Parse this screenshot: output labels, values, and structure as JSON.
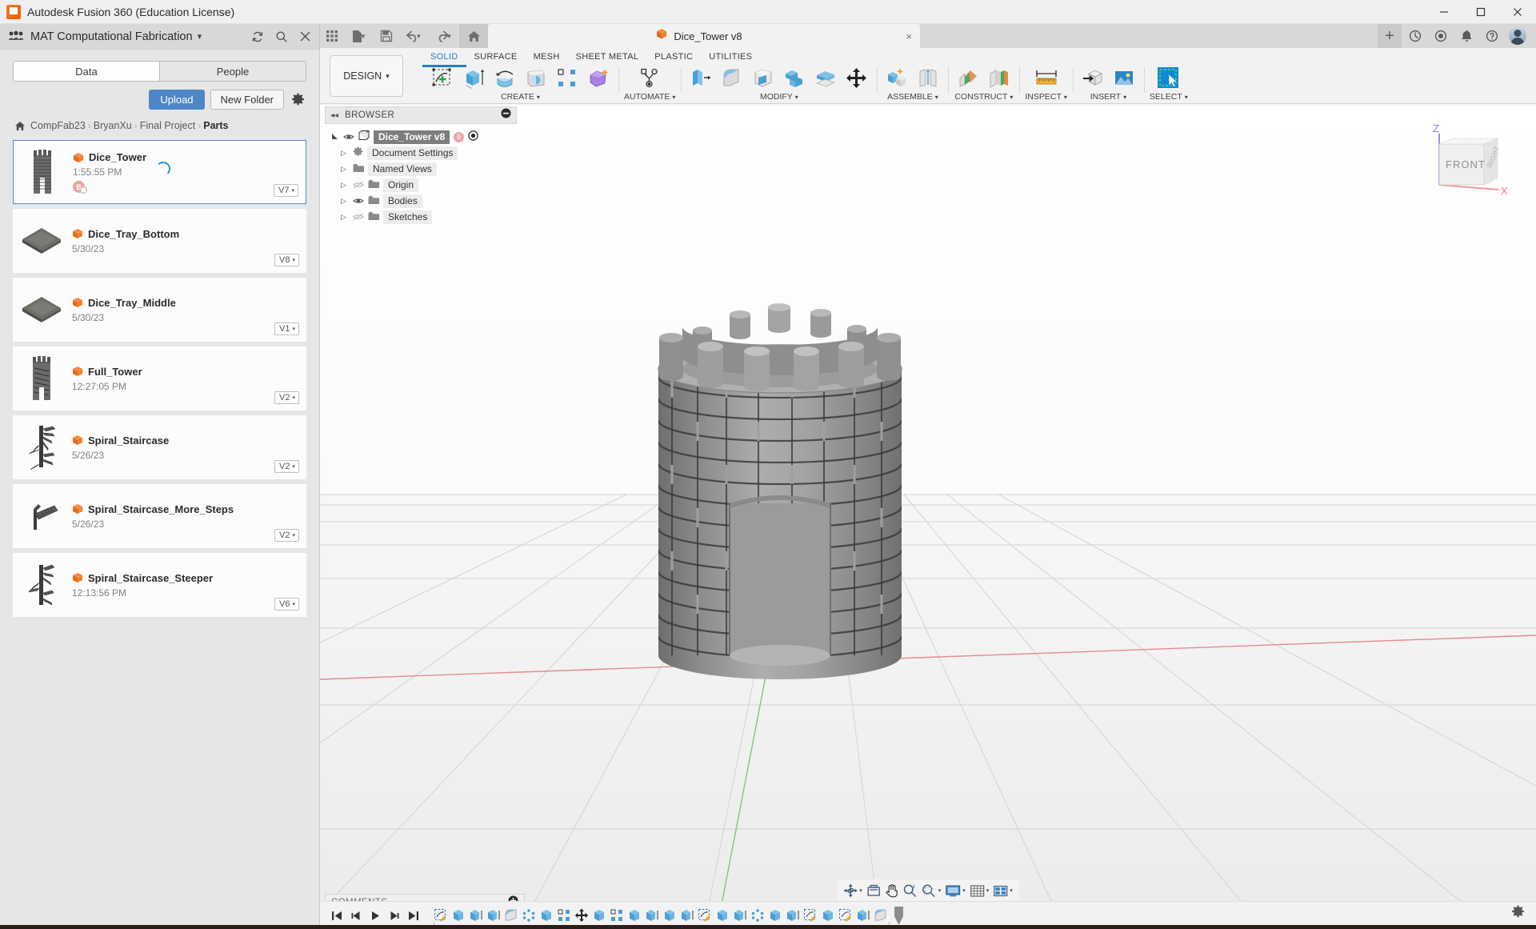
{
  "window": {
    "title": "Autodesk Fusion 360 (Education License)",
    "icon": "fusion-app-icon",
    "minimize": "minimize-icon",
    "maximize": "maximize-icon",
    "close": "close-icon"
  },
  "data_panel": {
    "hub_name": "MAT Computational Fabrication",
    "hub_caret": "▾",
    "header_icons": [
      "refresh-icon",
      "search-icon",
      "close-icon"
    ],
    "tabs": [
      {
        "label": "Data",
        "active": true
      },
      {
        "label": "People",
        "active": false
      }
    ],
    "upload_label": "Upload",
    "new_folder_label": "New Folder",
    "settings_icon": "gear-icon",
    "breadcrumb": [
      "CompFab23",
      "BryanXu",
      "Final Project",
      "Parts"
    ],
    "breadcrumb_separator": "›",
    "files": [
      {
        "name": "Dice_Tower",
        "date": "1:55:55 PM",
        "version": "V7",
        "selected": true,
        "spinner": true,
        "avatar": "B",
        "thumb": "tower"
      },
      {
        "name": "Dice_Tray_Bottom",
        "date": "5/30/23",
        "version": "V8",
        "selected": false,
        "spinner": false,
        "avatar": "",
        "thumb": "tray"
      },
      {
        "name": "Dice_Tray_Middle",
        "date": "5/30/23",
        "version": "V1",
        "selected": false,
        "spinner": false,
        "avatar": "",
        "thumb": "tray"
      },
      {
        "name": "Full_Tower",
        "date": "12:27:05 PM",
        "version": "V2",
        "selected": false,
        "spinner": false,
        "avatar": "",
        "thumb": "tower"
      },
      {
        "name": "Spiral_Staircase",
        "date": "5/26/23",
        "version": "V2",
        "selected": false,
        "spinner": false,
        "avatar": "",
        "thumb": "stair"
      },
      {
        "name": "Spiral_Staircase_More_Steps",
        "date": "5/26/23",
        "version": "V2",
        "selected": false,
        "spinner": false,
        "avatar": "",
        "thumb": "stair"
      },
      {
        "name": "Spiral_Staircase_Steeper",
        "date": "12:13:56 PM",
        "version": "V6",
        "selected": false,
        "spinner": false,
        "avatar": "",
        "thumb": "stair"
      }
    ],
    "version_caret": "▾"
  },
  "app_toolbar": {
    "buttons": [
      "grid-apps-icon",
      "new-file-icon",
      "save-icon",
      "undo-icon",
      "redo-icon"
    ],
    "home_icon": "home-icon",
    "document_tab": {
      "name": "Dice_Tower v8",
      "icon": "fusion-doc-icon",
      "close": "×"
    },
    "right_buttons": [
      "add-tab-icon",
      "notifications-activity-icon",
      "job-status-icon",
      "bell-icon",
      "help-icon",
      "account-avatar"
    ]
  },
  "ribbon": {
    "workspace_label": "DESIGN",
    "workspace_caret": "▾",
    "tabs": [
      {
        "label": "SOLID",
        "active": true
      },
      {
        "label": "SURFACE",
        "active": false
      },
      {
        "label": "MESH",
        "active": false
      },
      {
        "label": "SHEET METAL",
        "active": false
      },
      {
        "label": "PLASTIC",
        "active": false
      },
      {
        "label": "UTILITIES",
        "active": false
      }
    ],
    "groups": [
      {
        "label": "CREATE",
        "caret": "▾",
        "icons": [
          "create-sketch-icon",
          "extrude-icon",
          "revolve-icon",
          "sweep-icon",
          "pattern-icon",
          "form-icon"
        ]
      },
      {
        "label": "AUTOMATE",
        "caret": "▾",
        "icons": [
          "automate-icon"
        ]
      },
      {
        "label": "MODIFY",
        "caret": "▾",
        "icons": [
          "press-pull-icon",
          "fillet-icon",
          "shell-icon",
          "combine-icon",
          "offset-face-icon",
          "move-copy-icon"
        ]
      },
      {
        "label": "ASSEMBLE",
        "caret": "▾",
        "icons": [
          "new-component-icon",
          "joint-icon"
        ]
      },
      {
        "label": "CONSTRUCT",
        "caret": "▾",
        "icons": [
          "offset-plane-icon",
          "plane-at-angle-icon"
        ]
      },
      {
        "label": "INSPECT",
        "caret": "▾",
        "icons": [
          "measure-icon"
        ]
      },
      {
        "label": "INSERT",
        "caret": "▾",
        "icons": [
          "insert-derive-icon",
          "insert-canvas-icon"
        ]
      },
      {
        "label": "SELECT",
        "caret": "▾",
        "icons": [
          "select-window-icon"
        ]
      }
    ]
  },
  "browser": {
    "title": "BROWSER",
    "collapse_icon": "◂◂",
    "minimize_icon": "minus-circle-icon",
    "tree": [
      {
        "label": "Dice_Tower v8",
        "level": 0,
        "root": true,
        "expanded": true,
        "eye": "on",
        "extra": "B"
      },
      {
        "label": "Document Settings",
        "level": 1,
        "root": false,
        "expanded": false,
        "eye": "none",
        "icon": "gear-icon"
      },
      {
        "label": "Named Views",
        "level": 1,
        "root": false,
        "expanded": false,
        "eye": "none",
        "icon": "folder-icon"
      },
      {
        "label": "Origin",
        "level": 1,
        "root": false,
        "expanded": false,
        "eye": "off",
        "icon": "folder-icon"
      },
      {
        "label": "Bodies",
        "level": 1,
        "root": false,
        "expanded": false,
        "eye": "on",
        "icon": "folder-icon"
      },
      {
        "label": "Sketches",
        "level": 1,
        "root": false,
        "expanded": false,
        "eye": "off",
        "icon": "folder-icon"
      }
    ],
    "expand_triangle": "▷"
  },
  "viewcube": {
    "face_label": "FRONT",
    "side_label": "RIGHT",
    "axis_z": "Z",
    "axis_x": "X"
  },
  "nav_bar": {
    "items": [
      "orbit-icon",
      "pan-icon",
      "zoom-icon",
      "fit-icon",
      "display-settings-icon",
      "grid-snaps-icon",
      "viewports-icon"
    ],
    "caret": "▾"
  },
  "comments": {
    "label": "COMMENTS",
    "add_icon": "plus-circle-icon"
  },
  "timeline": {
    "playback": [
      "go-to-beginning-icon",
      "step-back-icon",
      "play-icon",
      "step-forward-icon",
      "go-to-end-icon"
    ],
    "feature_count": 26,
    "features": [
      "sketch-icon",
      "extrude-icon",
      "extrude-icon",
      "extrude-icon",
      "fillet-icon",
      "circular-pattern-icon",
      "extrude-icon",
      "rectangular-pattern-icon",
      "move-icon",
      "extrude-icon",
      "rectangular-pattern-icon",
      "extrude-icon",
      "extrude-icon",
      "extrude-icon",
      "extrude-icon",
      "sketch-icon",
      "extrude-icon",
      "extrude-icon",
      "circular-pattern-icon",
      "extrude-icon",
      "extrude-icon",
      "sketch-icon",
      "extrude-icon",
      "sketch-icon",
      "extrude-icon",
      "fillet-icon"
    ],
    "end_marker": "timeline-marker"
  },
  "status_bar": {
    "settings_icon": "gear-icon"
  },
  "model": {
    "description": "Dice tower — cylindrical castle tower with crenellated top and brick texture",
    "brick_rows": 13
  },
  "colors": {
    "accent_blue": "#2b7cc4",
    "upload_blue": "#4d87c7",
    "panel_gray": "#e6e6e6",
    "ribbon_gray": "#f2f2f2",
    "model_gray": "#8c8c8c",
    "avatar_pink": "#e8a3a3",
    "spinner_blue": "#2196d6"
  }
}
